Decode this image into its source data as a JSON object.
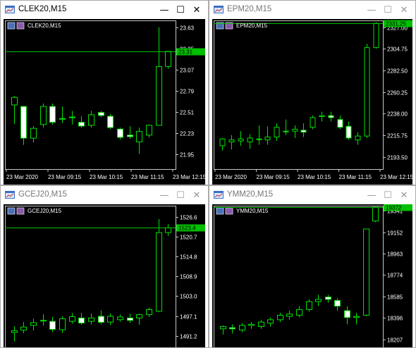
{
  "windows": [
    {
      "title": "CLEK20,M15",
      "symbol_label": "CLEK20,M15",
      "active": true,
      "chart_data": {
        "type": "candlestick",
        "symbol": "CLEK20",
        "timeframe": "M15",
        "y_ticks": [
          21.95,
          22.23,
          22.51,
          22.79,
          23.07,
          23.35,
          23.63
        ],
        "y_tick_labels": [
          "21.95",
          "22.23",
          "22.51",
          "22.79",
          "23.07",
          "23.35",
          "23.63"
        ],
        "ylim": [
          21.75,
          23.72
        ],
        "x_tick_labels": [
          "23 Mar 2020",
          "23 Mar 09:15",
          "23 Mar 10:15",
          "23 Mar 11:15",
          "23 Mar 12:15"
        ],
        "current_price": 23.31,
        "current_price_label": "23.31",
        "candles": [
          {
            "o": 22.6,
            "h": 22.72,
            "l": 22.35,
            "c": 22.7
          },
          {
            "o": 22.58,
            "h": 22.58,
            "l": 22.07,
            "c": 22.16
          },
          {
            "o": 22.16,
            "h": 22.32,
            "l": 22.1,
            "c": 22.29
          },
          {
            "o": 22.34,
            "h": 22.62,
            "l": 22.3,
            "c": 22.58
          },
          {
            "o": 22.58,
            "h": 22.62,
            "l": 22.34,
            "c": 22.37
          },
          {
            "o": 22.42,
            "h": 22.58,
            "l": 22.36,
            "c": 22.42
          },
          {
            "o": 22.44,
            "h": 22.52,
            "l": 22.34,
            "c": 22.44
          },
          {
            "o": 22.37,
            "h": 22.45,
            "l": 22.3,
            "c": 22.32
          },
          {
            "o": 22.33,
            "h": 22.52,
            "l": 22.3,
            "c": 22.47
          },
          {
            "o": 22.5,
            "h": 22.52,
            "l": 22.44,
            "c": 22.46
          },
          {
            "o": 22.45,
            "h": 22.48,
            "l": 22.28,
            "c": 22.3
          },
          {
            "o": 22.28,
            "h": 22.3,
            "l": 22.14,
            "c": 22.17
          },
          {
            "o": 22.2,
            "h": 22.32,
            "l": 22.15,
            "c": 22.18
          },
          {
            "o": 22.11,
            "h": 22.3,
            "l": 21.95,
            "c": 22.25
          },
          {
            "o": 22.2,
            "h": 22.34,
            "l": 22.17,
            "c": 22.33
          },
          {
            "o": 22.33,
            "h": 23.63,
            "l": 22.33,
            "c": 23.11
          },
          {
            "o": 23.11,
            "h": 23.31,
            "l": 23.08,
            "c": 23.31
          }
        ]
      }
    },
    {
      "title": "EPM20,M15",
      "symbol_label": "EPM20,M15",
      "active": false,
      "chart_data": {
        "type": "candlestick",
        "symbol": "EPM20",
        "timeframe": "M15",
        "y_ticks": [
          2193.5,
          2215.75,
          2238.0,
          2260.25,
          2282.5,
          2304.75,
          2327.0
        ],
        "y_tick_labels": [
          "2193.50",
          "2215.75",
          "2238.00",
          "2260.25",
          "2282.50",
          "2304.75",
          "2327.00"
        ],
        "ylim": [
          2181,
          2334
        ],
        "x_tick_labels": [
          "23 Mar 2020",
          "23 Mar 09:15",
          "23 Mar 10:15",
          "23 Mar 11:15",
          "23 Mar 12:15"
        ],
        "current_price": 2331.25,
        "current_price_label": "2331.25",
        "candles": [
          {
            "o": 2205,
            "h": 2213,
            "l": 2200,
            "c": 2212
          },
          {
            "o": 2209,
            "h": 2216,
            "l": 2201,
            "c": 2211
          },
          {
            "o": 2210,
            "h": 2220,
            "l": 2205,
            "c": 2212
          },
          {
            "o": 2209,
            "h": 2217,
            "l": 2202,
            "c": 2213
          },
          {
            "o": 2212,
            "h": 2226,
            "l": 2206,
            "c": 2212
          },
          {
            "o": 2211,
            "h": 2225,
            "l": 2206,
            "c": 2214
          },
          {
            "o": 2214,
            "h": 2228,
            "l": 2210,
            "c": 2224
          },
          {
            "o": 2220,
            "h": 2232,
            "l": 2216,
            "c": 2220
          },
          {
            "o": 2220,
            "h": 2226,
            "l": 2213,
            "c": 2222
          },
          {
            "o": 2221,
            "h": 2228,
            "l": 2214,
            "c": 2219
          },
          {
            "o": 2224,
            "h": 2236,
            "l": 2222,
            "c": 2234
          },
          {
            "o": 2235,
            "h": 2240,
            "l": 2230,
            "c": 2236
          },
          {
            "o": 2236,
            "h": 2240,
            "l": 2230,
            "c": 2234
          },
          {
            "o": 2232,
            "h": 2236,
            "l": 2222,
            "c": 2224
          },
          {
            "o": 2225,
            "h": 2230,
            "l": 2211,
            "c": 2213
          },
          {
            "o": 2211,
            "h": 2219,
            "l": 2206,
            "c": 2215
          },
          {
            "o": 2215,
            "h": 2310,
            "l": 2213,
            "c": 2306
          },
          {
            "o": 2306,
            "h": 2332,
            "l": 2305,
            "c": 2331
          }
        ]
      }
    },
    {
      "title": "GCEJ20,M15",
      "symbol_label": "GCEJ20,M15",
      "active": false,
      "chart_data": {
        "type": "candlestick",
        "symbol": "GCEJ20",
        "timeframe": "M15",
        "y_ticks": [
          1491.2,
          1497.1,
          1503.0,
          1508.9,
          1514.8,
          1520.7,
          1526.6
        ],
        "y_tick_labels": [
          "1491.2",
          "1497.1",
          "1503.0",
          "1508.9",
          "1514.8",
          "1520.7",
          "1526.6"
        ],
        "ylim": [
          1486.5,
          1530
        ],
        "x_tick_labels": [],
        "current_price": 1523.4,
        "current_price_label": "1523.4",
        "candles": [
          {
            "o": 1492.2,
            "h": 1494.0,
            "l": 1489.5,
            "c": 1492.7
          },
          {
            "o": 1492.9,
            "h": 1495.3,
            "l": 1491.9,
            "c": 1493.8
          },
          {
            "o": 1494.3,
            "h": 1496.3,
            "l": 1492.8,
            "c": 1495.1
          },
          {
            "o": 1495.6,
            "h": 1497.6,
            "l": 1494.2,
            "c": 1495.8
          },
          {
            "o": 1495.5,
            "h": 1496.8,
            "l": 1492.3,
            "c": 1493.1
          },
          {
            "o": 1493.0,
            "h": 1497.0,
            "l": 1492.1,
            "c": 1496.3
          },
          {
            "o": 1495.5,
            "h": 1498.0,
            "l": 1494.8,
            "c": 1496.9
          },
          {
            "o": 1496.5,
            "h": 1498.0,
            "l": 1494.5,
            "c": 1495.0
          },
          {
            "o": 1495.5,
            "h": 1497.8,
            "l": 1494.6,
            "c": 1496.5
          },
          {
            "o": 1497.0,
            "h": 1498.8,
            "l": 1494.6,
            "c": 1495.2
          },
          {
            "o": 1495.3,
            "h": 1497.9,
            "l": 1494.4,
            "c": 1497.0
          },
          {
            "o": 1496.0,
            "h": 1497.5,
            "l": 1495.4,
            "c": 1496.8
          },
          {
            "o": 1496.5,
            "h": 1497.8,
            "l": 1495.0,
            "c": 1495.8
          },
          {
            "o": 1496.5,
            "h": 1497.8,
            "l": 1494.5,
            "c": 1497.5
          },
          {
            "o": 1497.5,
            "h": 1499.6,
            "l": 1496.8,
            "c": 1499.0
          },
          {
            "o": 1498.5,
            "h": 1526.0,
            "l": 1498.3,
            "c": 1522.0
          },
          {
            "o": 1522.0,
            "h": 1524.5,
            "l": 1521.0,
            "c": 1523.4
          }
        ]
      }
    },
    {
      "title": "YMM20,M15",
      "symbol_label": "YMM20,M15",
      "active": false,
      "chart_data": {
        "type": "candlestick",
        "symbol": "YMM20",
        "timeframe": "M15",
        "y_ticks": [
          18207,
          18396,
          18585,
          18774,
          18963,
          19152,
          19341
        ],
        "y_tick_labels": [
          "18207",
          "18396",
          "18585",
          "18774",
          "18963",
          "19152",
          "19341"
        ],
        "ylim": [
          18100,
          19385
        ],
        "x_tick_labels": [],
        "current_price": 19372,
        "current_price_label": "19372",
        "candles": [
          {
            "o": 18300,
            "h": 18330,
            "l": 18250,
            "c": 18320
          },
          {
            "o": 18310,
            "h": 18340,
            "l": 18260,
            "c": 18300
          },
          {
            "o": 18290,
            "h": 18350,
            "l": 18270,
            "c": 18330
          },
          {
            "o": 18330,
            "h": 18360,
            "l": 18300,
            "c": 18340
          },
          {
            "o": 18320,
            "h": 18380,
            "l": 18300,
            "c": 18360
          },
          {
            "o": 18350,
            "h": 18400,
            "l": 18320,
            "c": 18380
          },
          {
            "o": 18380,
            "h": 18440,
            "l": 18360,
            "c": 18420
          },
          {
            "o": 18410,
            "h": 18460,
            "l": 18380,
            "c": 18430
          },
          {
            "o": 18420,
            "h": 18500,
            "l": 18400,
            "c": 18470
          },
          {
            "o": 18470,
            "h": 18560,
            "l": 18450,
            "c": 18540
          },
          {
            "o": 18540,
            "h": 18600,
            "l": 18500,
            "c": 18560
          },
          {
            "o": 18580,
            "h": 18600,
            "l": 18530,
            "c": 18560
          },
          {
            "o": 18550,
            "h": 18570,
            "l": 18460,
            "c": 18500
          },
          {
            "o": 18460,
            "h": 18500,
            "l": 18340,
            "c": 18400
          },
          {
            "o": 18400,
            "h": 18440,
            "l": 18340,
            "c": 18410
          },
          {
            "o": 18420,
            "h": 19180,
            "l": 18410,
            "c": 19180
          },
          {
            "o": 19250,
            "h": 19385,
            "l": 19240,
            "c": 19372
          }
        ]
      }
    }
  ],
  "colors": {
    "chart_bg": "#000000",
    "axis_text": "#ffffff",
    "grid": "#5a5a5a",
    "bull_fill": "#000000",
    "bear_fill": "#ffffff",
    "candle_outline": "#00e000",
    "price_line": "#00c000",
    "price_label_bg": "#00c000",
    "price_label_text": "#000000"
  },
  "icons": {
    "app": "chart-window-icon",
    "minimize": "minimize-icon",
    "maximize": "maximize-icon",
    "close": "close-icon"
  }
}
